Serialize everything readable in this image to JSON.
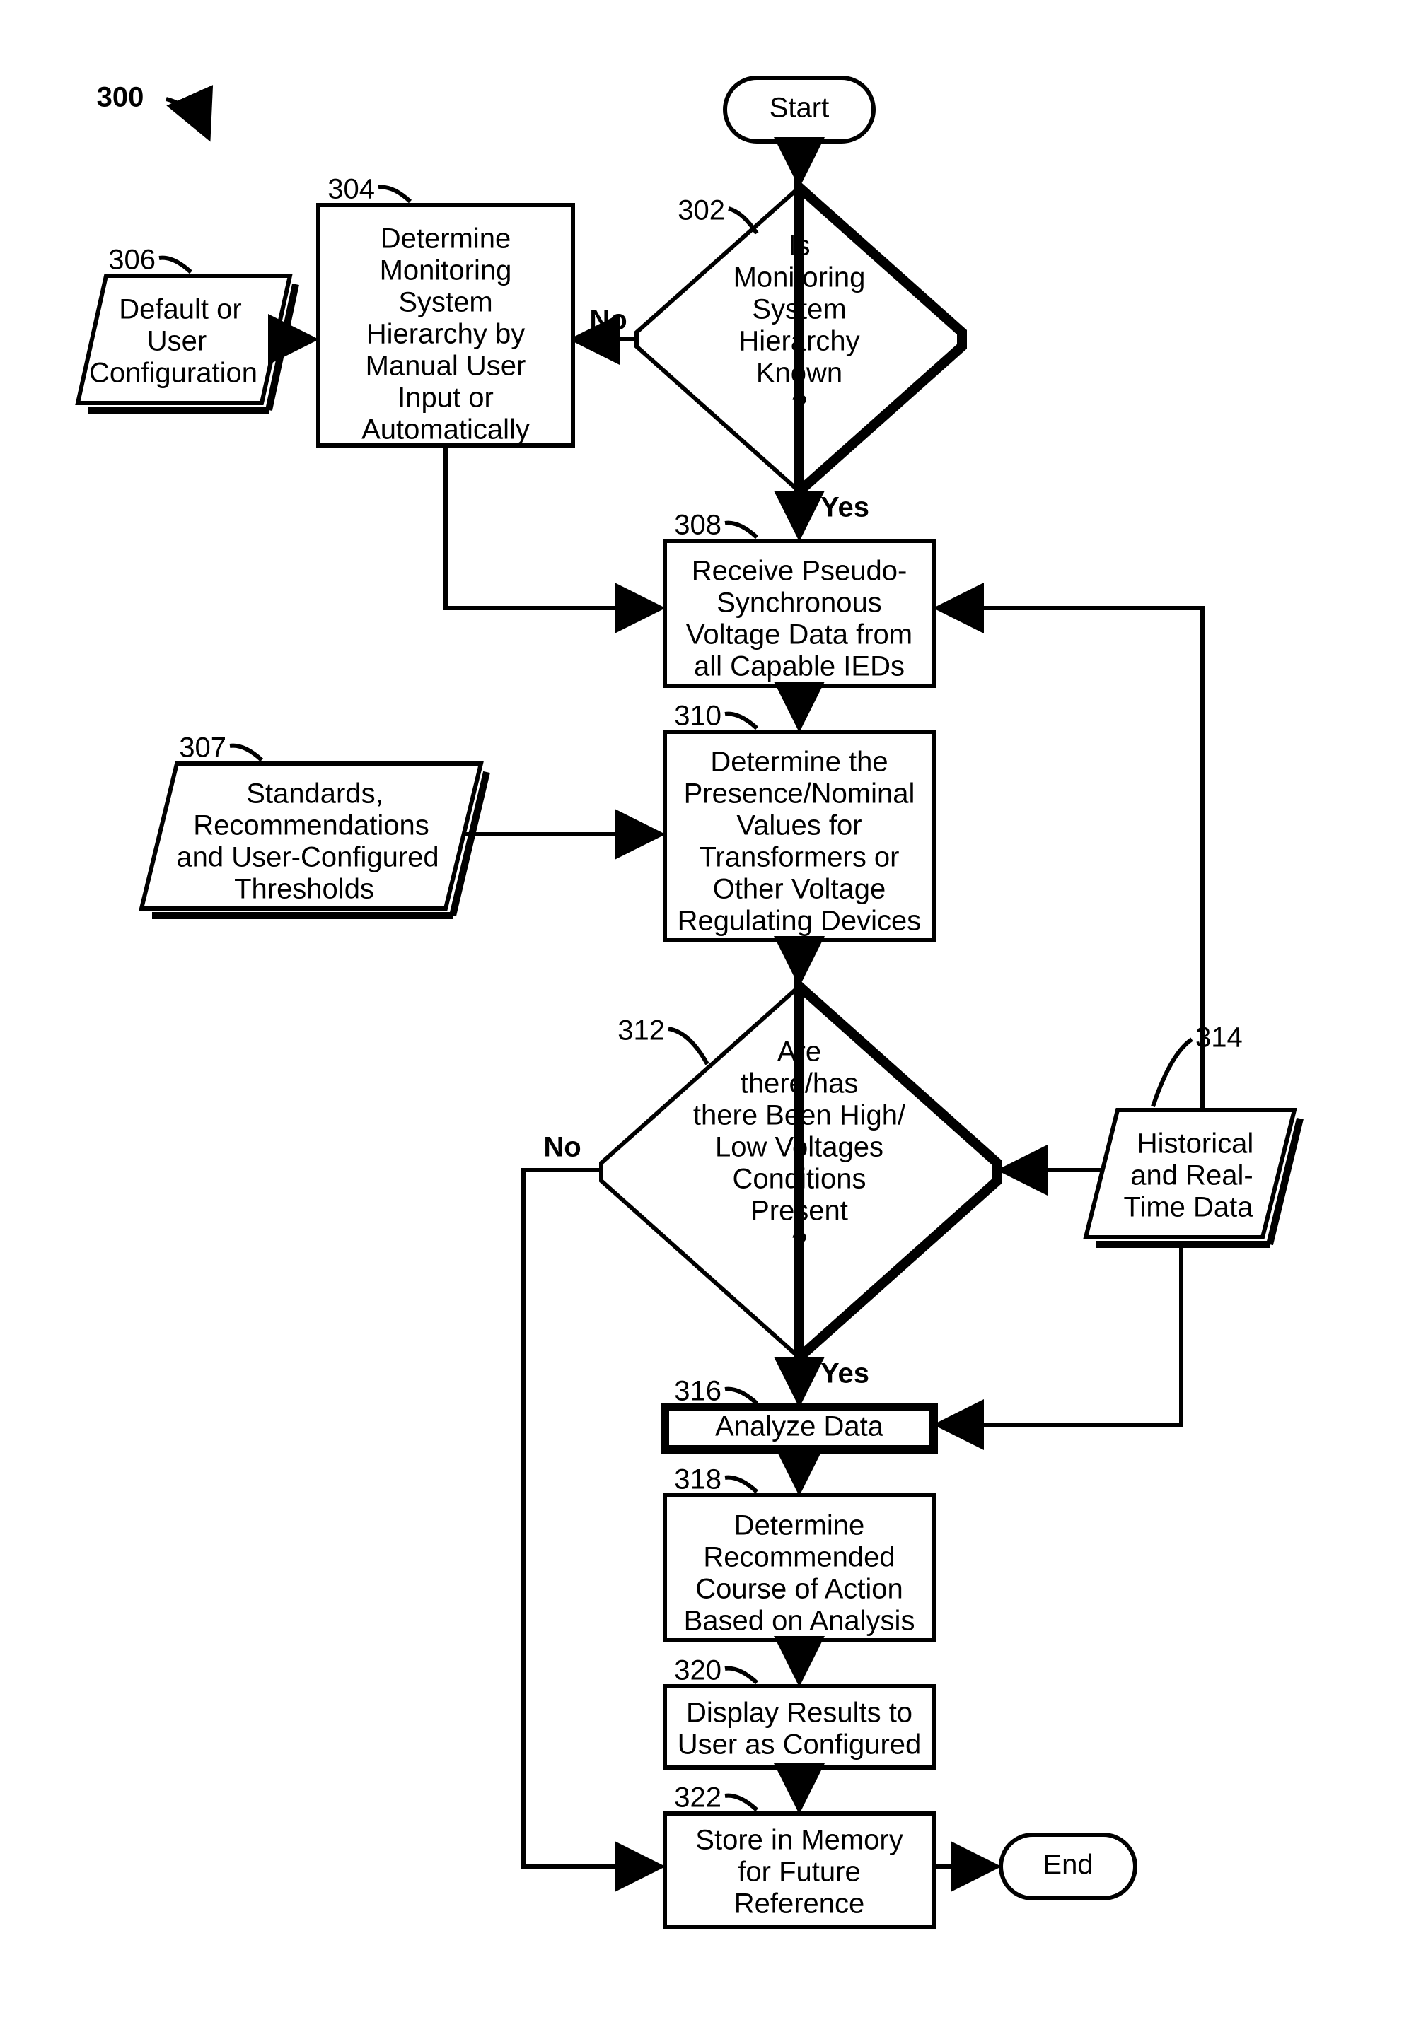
{
  "figureRef": "300",
  "start": {
    "label": "Start"
  },
  "end": {
    "label": "End"
  },
  "n302": {
    "ref": "302",
    "l1": "Is",
    "l2": "Monitoring",
    "l3": "System",
    "l4": "Hierarchy",
    "l5": "Known",
    "l6": "?",
    "yes": "Yes",
    "no": "No"
  },
  "n304": {
    "ref": "304",
    "l1": "Determine",
    "l2": "Monitoring",
    "l3": "System",
    "l4": "Hierarchy by",
    "l5": "Manual User",
    "l6": "Input or",
    "l7": "Automatically"
  },
  "n306": {
    "ref": "306",
    "l1": "Default or",
    "l2": "User",
    "l3": "Configuration"
  },
  "n307": {
    "ref": "307",
    "l1": "Standards,",
    "l2": "Recommendations",
    "l3": "and User-Configured",
    "l4": "Thresholds"
  },
  "n308": {
    "ref": "308",
    "l1": "Receive Pseudo-",
    "l2": "Synchronous",
    "l3": "Voltage Data from",
    "l4": "all Capable IEDs"
  },
  "n310": {
    "ref": "310",
    "l1": "Determine the",
    "l2": "Presence/Nominal",
    "l3": "Values for",
    "l4": "Transformers or",
    "l5": "Other Voltage",
    "l6": "Regulating Devices"
  },
  "n312": {
    "ref": "312",
    "l1": "Are",
    "l2": "there/has",
    "l3": "there Been High/",
    "l4": "Low Voltages",
    "l5": "Conditions",
    "l6": "Present",
    "l7": "?",
    "yes": "Yes",
    "no": "No"
  },
  "n314": {
    "ref": "314",
    "l1": "Historical",
    "l2": "and Real-",
    "l3": "Time Data"
  },
  "n316": {
    "ref": "316",
    "l1": "Analyze Data"
  },
  "n318": {
    "ref": "318",
    "l1": "Determine",
    "l2": "Recommended",
    "l3": "Course of Action",
    "l4": "Based on Analysis"
  },
  "n320": {
    "ref": "320",
    "l1": "Display Results to",
    "l2": "User as Configured"
  },
  "n322": {
    "ref": "322",
    "l1": "Store in Memory",
    "l2": "for Future",
    "l3": "Reference"
  }
}
